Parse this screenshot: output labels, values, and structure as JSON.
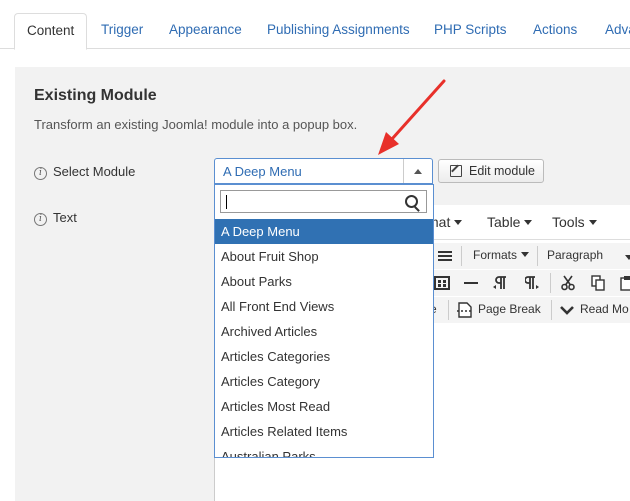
{
  "tabs": [
    {
      "label": "Content"
    },
    {
      "label": "Trigger"
    },
    {
      "label": "Appearance"
    },
    {
      "label": "Publishing Assignments"
    },
    {
      "label": "PHP Scripts"
    },
    {
      "label": "Actions"
    },
    {
      "label": "Adva"
    }
  ],
  "section": {
    "title": "Existing Module",
    "description": "Transform an existing Joomla! module into a popup box."
  },
  "fields": {
    "select_module_label": "Select Module",
    "text_label": "Text",
    "info_icon_glyph": "i"
  },
  "select": {
    "value": "A Deep Menu",
    "search_value": "",
    "options": [
      "A Deep Menu",
      "About Fruit Shop",
      "About Parks",
      "All Front End Views",
      "Archived Articles",
      "Articles Categories",
      "Articles Category",
      "Articles Most Read",
      "Articles Related Items",
      "Australian Parks"
    ],
    "selected_index": 0
  },
  "edit_button": {
    "label": "Edit module"
  },
  "editor": {
    "menubar": {
      "format": "mat",
      "table": "Table",
      "tools": "Tools"
    },
    "toolbar1": {
      "formats": "Formats",
      "paragraph": "Paragraph"
    },
    "toolbar3": {
      "partial": "e",
      "page_break": "Page Break",
      "read_more": "Read Mo"
    }
  },
  "colors": {
    "accent": "#2f6cb3",
    "selected": "#3071b3",
    "annotation_arrow": "#e8302a"
  }
}
